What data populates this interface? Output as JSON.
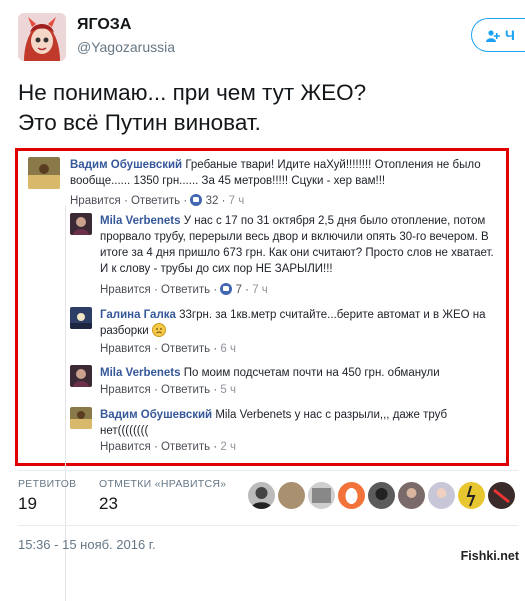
{
  "tweet": {
    "author_name": "ЯГОЗА",
    "author_handle": "@Yagozarussia",
    "follow_label": "Ч",
    "text_lines": [
      "Не понимаю... при чем тут ЖЕО?",
      "Это всё Путин виноват."
    ],
    "stats": {
      "retweets_label": "РЕТВИТОВ",
      "retweets": "19",
      "likes_label": "ОТМЕТКИ «НРАВИТСЯ»",
      "likes": "23"
    },
    "timestamp": "15:36 - 15 нояб. 2016 г."
  },
  "embedded_comments": [
    {
      "author": "Вадим Обушевский",
      "text": "Гребаные твари! Идите наХуй!!!!!!!! Отопления не было вообще...... 1350 грн...... За 45 метров!!!!! Сцуки - хер вам!!!",
      "like_label": "Нравится",
      "reply_label": "Ответить",
      "likes": "32",
      "time": "7 ч"
    },
    {
      "author": "Mila Verbenets",
      "text": "У нас с 17 по 31 октября 2,5 дня было отопление, потом прорвало трубу, перерыли весь двор и включили опять 30-го вечером. В итоге за 4 дня пришло 673 грн. Как они считают? Просто слов не хватает. И к слову - трубы до сих пор НЕ ЗАРЫЛИ!!!",
      "like_label": "Нравится",
      "reply_label": "Ответить",
      "likes": "7",
      "time": "7 ч"
    },
    {
      "author": "Галина Галка",
      "text": "33грн. за 1кв.метр считайте...берите автомат и в ЖЕО на разборки",
      "like_label": "Нравится",
      "reply_label": "Ответить",
      "time": "6 ч"
    },
    {
      "author": "Mila Verbenets",
      "text": "По моим подсчетам почти на 450 грн. обманули",
      "like_label": "Нравится",
      "reply_label": "Ответить",
      "time": "5 ч"
    },
    {
      "author": "Вадим Обушевский",
      "mention": "Mila Verbenets",
      "text": "у нас с разрыли,,, даже труб нет((((((((",
      "like_label": "Нравится",
      "reply_label": "Ответить",
      "time": "2 ч"
    }
  ],
  "watermark": "Fishki.net",
  "colors": {
    "highlight_border": "#e00000",
    "fb_link": "#365899",
    "twitter_blue": "#1da1f2"
  },
  "icons": [
    "follow-person-icon",
    "like-thumb-icon",
    "sad-emoji-icon"
  ]
}
